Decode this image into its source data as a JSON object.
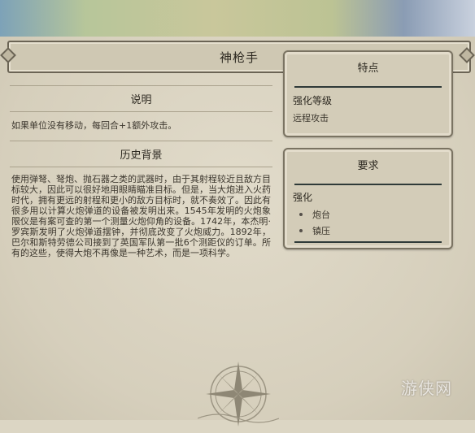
{
  "header": {
    "title": "神枪手"
  },
  "description": {
    "heading": "说明",
    "text": "如果单位没有移动，每回合+1额外攻击。"
  },
  "history": {
    "heading": "历史背景",
    "text": "使用弹弩、弩炮、抛石器之类的武器时，由于其射程较近且敌方目标较大，因此可以很好地用眼睛瞄准目标。但是，当大炮进入火药时代，拥有更远的射程和更小的敌方目标时，就不奏效了。因此有很多用以计算火炮弹道的设备被发明出来。1545年发明的火炮象限仪是有案可查的第一个测量火炮仰角的设备。1742年，本杰明·罗宾斯发明了火炮弹道摆钟，并彻底改变了火炮威力。1892年，巴尔和斯特劳德公司接到了英国军队第一批6个测距仪的订单。所有的这些，使得大炮不再像是一种艺术，而是一项科学。"
  },
  "traits": {
    "heading": "特点",
    "subheading": "强化等级",
    "item": "远程攻击"
  },
  "requirements": {
    "heading": "要求",
    "subheading": "强化",
    "items": [
      "炮台",
      "镇压"
    ]
  },
  "watermark": "游侠网"
}
